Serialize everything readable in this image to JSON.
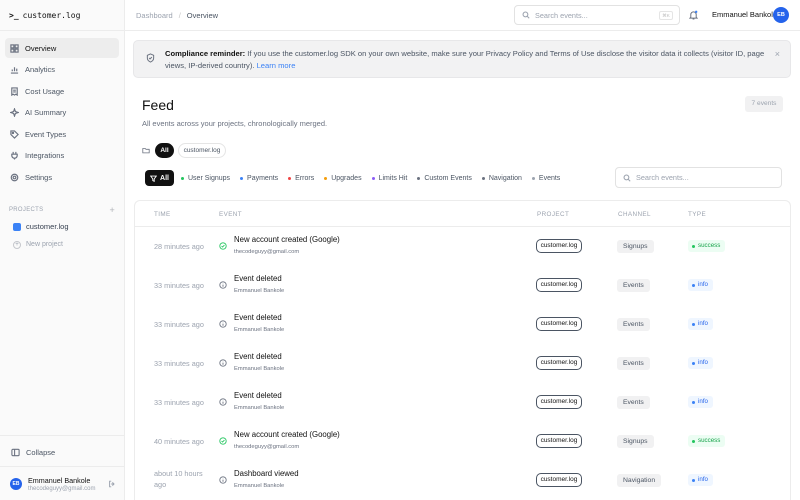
{
  "app": {
    "brand": "customer.log",
    "brand_prompt": ">_"
  },
  "sidebar": {
    "nav": [
      {
        "label": "Overview",
        "icon": "grid-icon",
        "active": true
      },
      {
        "label": "Analytics",
        "icon": "chart-icon"
      },
      {
        "label": "Cost Usage",
        "icon": "receipt-icon"
      },
      {
        "label": "AI Summary",
        "icon": "sparkle-icon"
      },
      {
        "label": "Event Types",
        "icon": "tag-icon"
      },
      {
        "label": "Integrations",
        "icon": "plug-icon"
      },
      {
        "label": "Settings",
        "icon": "gear-icon"
      }
    ],
    "projects_heading": "PROJECTS",
    "projects_add": "+",
    "projects": [
      {
        "label": "customer.log",
        "color": "#3b82f6"
      }
    ],
    "new_project": "New project",
    "collapse": "Collapse",
    "user": {
      "initials": "EB",
      "name": "Emmanuel Bankole",
      "email": "thecodeguyy@gmail.com"
    }
  },
  "topbar": {
    "breadcrumb": [
      "Dashboard",
      "Overview"
    ],
    "breadcrumb_sep": "/",
    "search_placeholder": "Search events...",
    "search_kbd": "⌘K",
    "user_name": "Emmanuel Bankole",
    "user_initials": "EB"
  },
  "banner": {
    "title": "Compliance reminder:",
    "text": " If you use the customer.log SDK on your own website, make sure your Privacy Policy and Terms of Use disclose the visitor data it collects (visitor ID, page views, IP-derived country). ",
    "link": "Learn more",
    "close": "×"
  },
  "feed": {
    "title": "Feed",
    "subtitle": "All events across your projects, chronologically merged.",
    "count": "7 events",
    "project_filters": [
      "All",
      "customer.log"
    ],
    "filter_all": "All",
    "filters": [
      {
        "label": "User Signups",
        "color": "#22c55e"
      },
      {
        "label": "Payments",
        "color": "#3b82f6"
      },
      {
        "label": "Errors",
        "color": "#ef4444"
      },
      {
        "label": "Upgrades",
        "color": "#f59e0b"
      },
      {
        "label": "Limits Hit",
        "color": "#8b5cf6"
      },
      {
        "label": "Custom Events",
        "color": "#6b7280"
      },
      {
        "label": "Navigation",
        "color": "#6b7280"
      },
      {
        "label": "Events",
        "color": "#9ca3af"
      }
    ],
    "table_search_placeholder": "Search events...",
    "columns": [
      "TIME",
      "EVENT",
      "PROJECT",
      "CHANNEL",
      "TYPE"
    ],
    "rows": [
      {
        "time": "28 minutes ago",
        "title": "New account created (Google)",
        "sub": "thecodeguyy@gmail.com",
        "project": "customer.log",
        "channel": "Signups",
        "type": "success",
        "icon": "check-circle-icon"
      },
      {
        "time": "33 minutes ago",
        "title": "Event deleted",
        "sub": "Emmanuel Bankole",
        "project": "customer.log",
        "channel": "Events",
        "type": "info",
        "icon": "info-circle-icon"
      },
      {
        "time": "33 minutes ago",
        "title": "Event deleted",
        "sub": "Emmanuel Bankole",
        "project": "customer.log",
        "channel": "Events",
        "type": "info",
        "icon": "info-circle-icon"
      },
      {
        "time": "33 minutes ago",
        "title": "Event deleted",
        "sub": "Emmanuel Bankole",
        "project": "customer.log",
        "channel": "Events",
        "type": "info",
        "icon": "info-circle-icon"
      },
      {
        "time": "33 minutes ago",
        "title": "Event deleted",
        "sub": "Emmanuel Bankole",
        "project": "customer.log",
        "channel": "Events",
        "type": "info",
        "icon": "info-circle-icon"
      },
      {
        "time": "40 minutes ago",
        "title": "New account created (Google)",
        "sub": "thecodeguyy@gmail.com",
        "project": "customer.log",
        "channel": "Signups",
        "type": "success",
        "icon": "check-circle-icon"
      },
      {
        "time": "about 10 hours ago",
        "title": "Dashboard viewed",
        "sub": "Emmanuel Bankole",
        "project": "customer.log",
        "channel": "Navigation",
        "type": "info",
        "icon": "info-circle-icon"
      }
    ]
  }
}
